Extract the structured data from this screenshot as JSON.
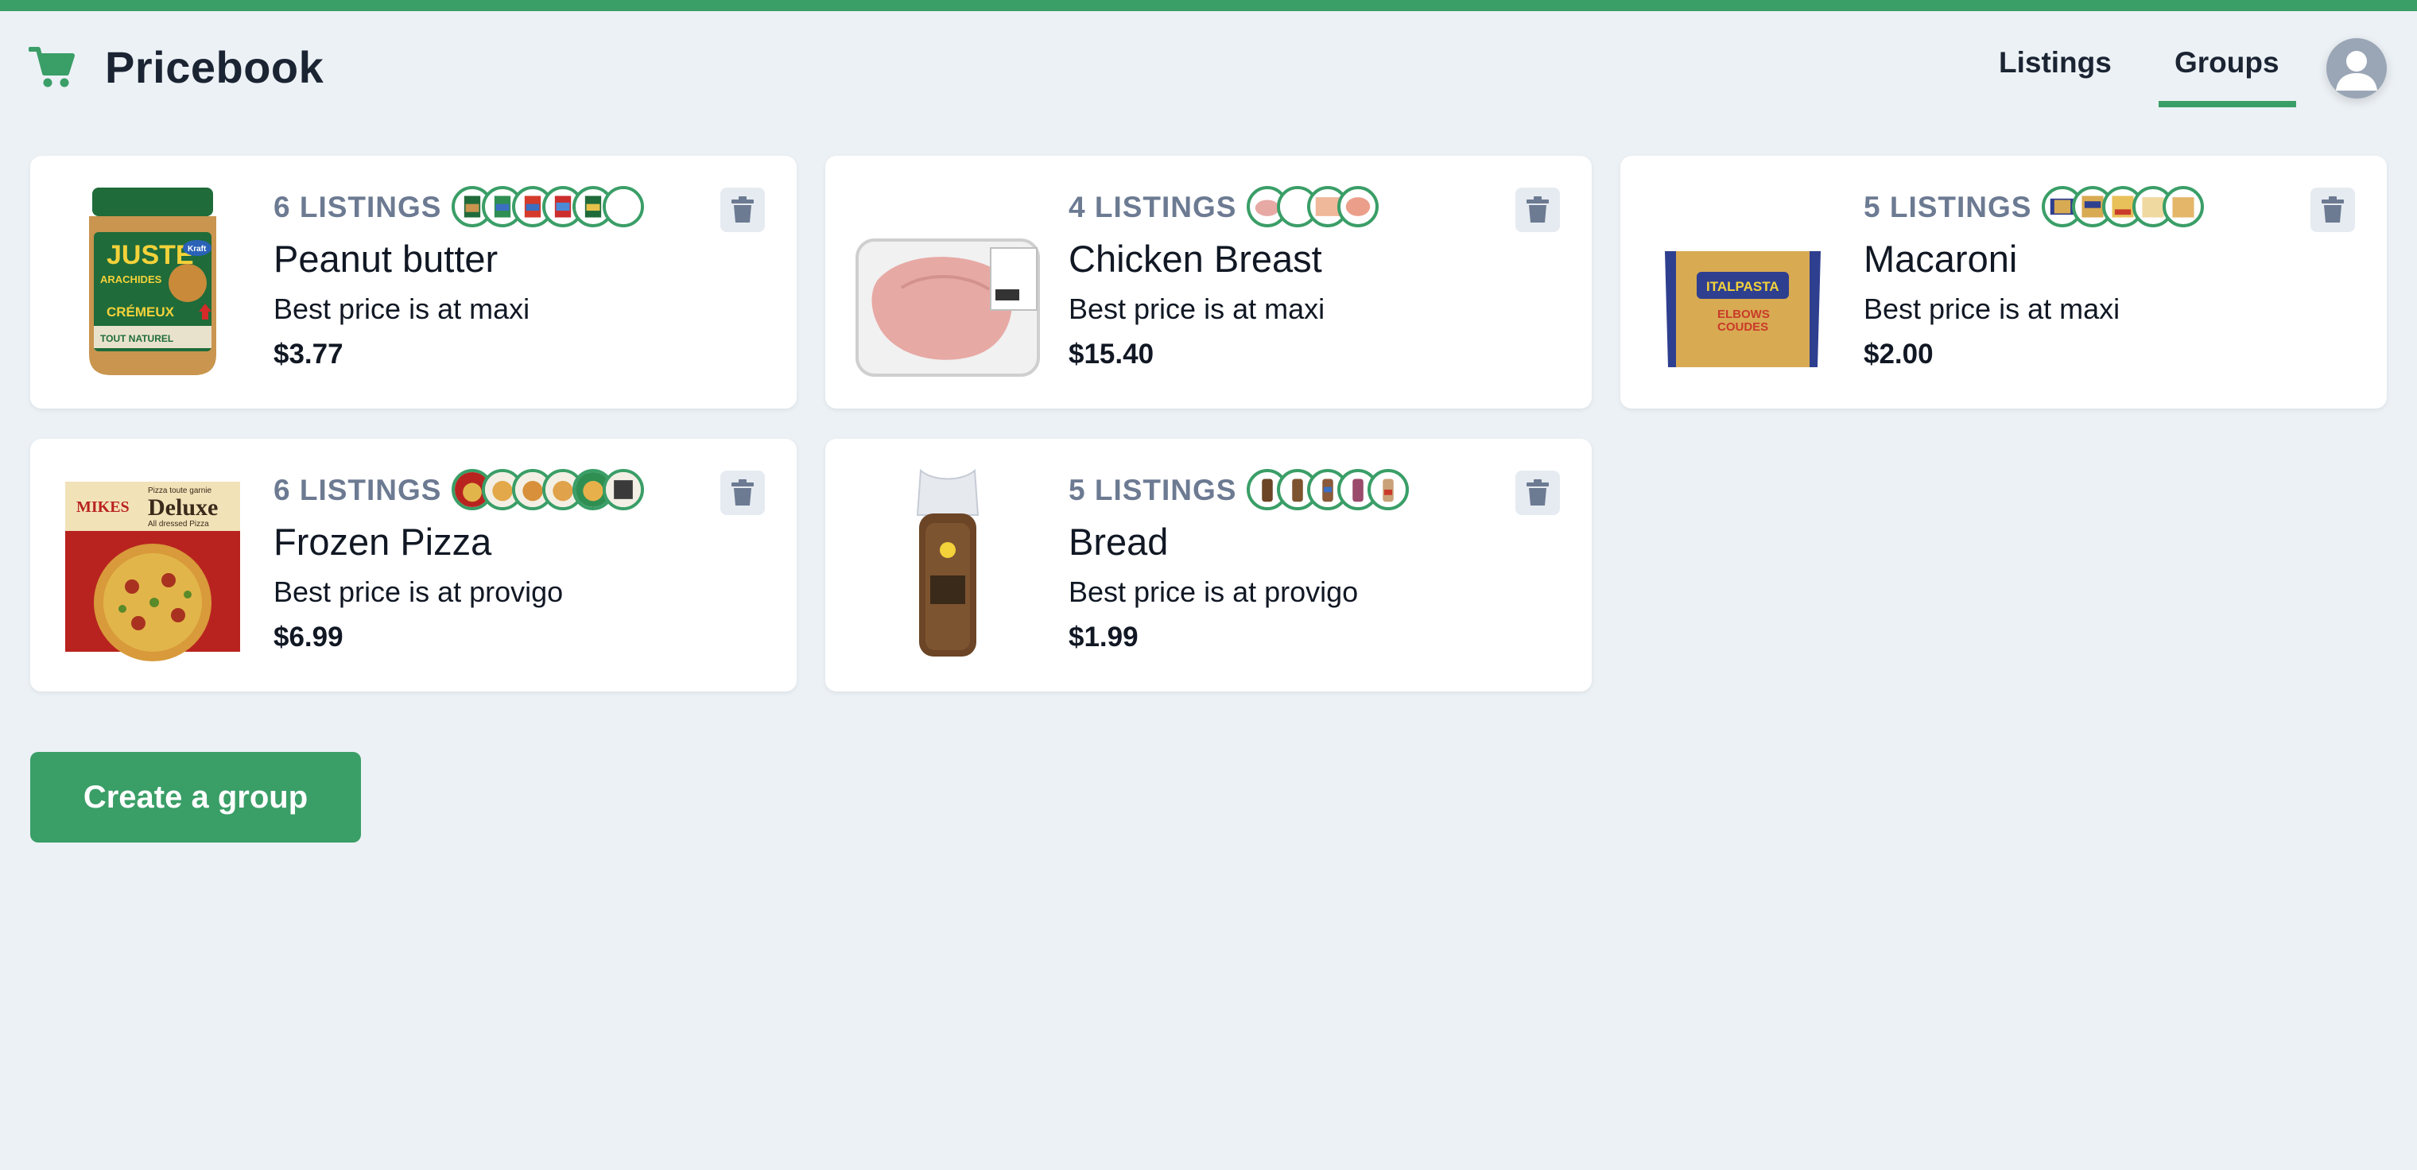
{
  "app": {
    "title": "Pricebook",
    "logo_icon": "shopping-cart-icon",
    "accent": "#3a9e67"
  },
  "nav": {
    "listings": "Listings",
    "groups": "Groups",
    "active": "Groups"
  },
  "groups": [
    {
      "count_label": "6 LISTINGS",
      "name": "Peanut butter",
      "best": "Best price is at maxi",
      "price": "$3.77",
      "thumbs": 6
    },
    {
      "count_label": "4 LISTINGS",
      "name": "Chicken Breast",
      "best": "Best price is at maxi",
      "price": "$15.40",
      "thumbs": 4
    },
    {
      "count_label": "5 LISTINGS",
      "name": "Macaroni",
      "best": "Best price is at maxi",
      "price": "$2.00",
      "thumbs": 5
    },
    {
      "count_label": "6 LISTINGS",
      "name": "Frozen Pizza",
      "best": "Best price is at provigo",
      "price": "$6.99",
      "thumbs": 6
    },
    {
      "count_label": "5 LISTINGS",
      "name": "Bread",
      "best": "Best price is at provigo",
      "price": "$1.99",
      "thumbs": 5
    }
  ],
  "product_image_labels": {
    "peanut_butter": [
      "JUSTE",
      "ARACHIDES",
      "CRÉMEUX",
      "TOUT NATUREL",
      "Kraft"
    ],
    "macaroni": [
      "ITALPASTA",
      "ELBOWS",
      "COUDES"
    ],
    "pizza": [
      "MIKES",
      "Deluxe",
      "Pizza toute garnie",
      "All dressed Pizza"
    ]
  },
  "create_button": "Create a group"
}
